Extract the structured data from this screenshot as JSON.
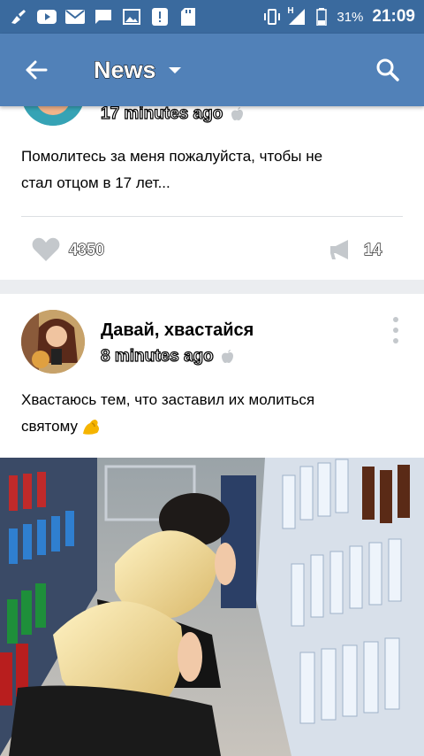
{
  "status_bar": {
    "battery": "31%",
    "time": "21:09",
    "network_type": "H"
  },
  "toolbar": {
    "title": "News"
  },
  "post1": {
    "time": "17 minutes ago",
    "text_line1": "Помолитесь за меня пожалуйста, чтобы не",
    "text_line2": "стал отцом в 17 лет...",
    "likes": "4350",
    "shares": "14"
  },
  "post2": {
    "author": "Давай, хвастайся",
    "time": "8 minutes ago",
    "text_line1": "Хвастаюсь тем, что заставил их молиться",
    "text_line2": "святому"
  },
  "colors": {
    "status_bar": "#3a6a9e",
    "toolbar": "#5181b8",
    "background": "#ebedf0",
    "icon_gray": "#c4c8cc"
  }
}
